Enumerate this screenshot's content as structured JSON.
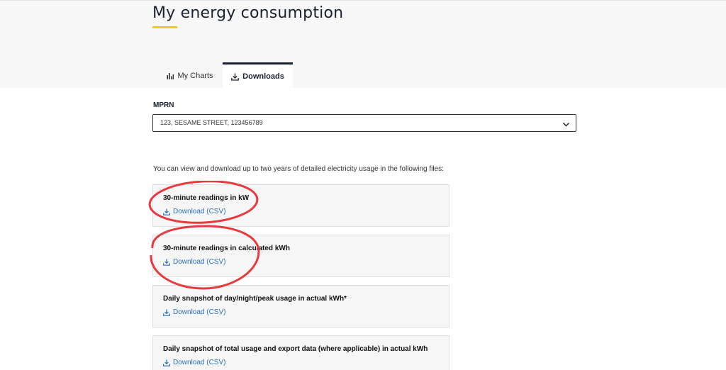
{
  "header": {
    "title": "My energy consumption",
    "accent_color": "#f5c518"
  },
  "tabs": [
    {
      "label": "My Charts",
      "icon": "bar-chart-icon",
      "active": false
    },
    {
      "label": "Downloads",
      "icon": "download-icon",
      "active": true
    }
  ],
  "mprn": {
    "label": "MPRN",
    "selected": "123, SESAME STREET, 123456789"
  },
  "intro_text": "You can view and download up to two years of detailed electricity usage in the following files:",
  "files": [
    {
      "title": "30-minute readings in kW",
      "link_label": "Download (CSV)"
    },
    {
      "title": "30-minute readings in calculated kWh",
      "link_label": "Download (CSV)"
    },
    {
      "title": "Daily snapshot of day/night/peak usage in actual kWh*",
      "link_label": "Download (CSV)"
    },
    {
      "title": "Daily snapshot of total usage and export data (where applicable) in actual kWh",
      "link_label": "Download (CSV)"
    }
  ],
  "annotation_color": "#e8393f",
  "link_color": "#2a6ebb"
}
